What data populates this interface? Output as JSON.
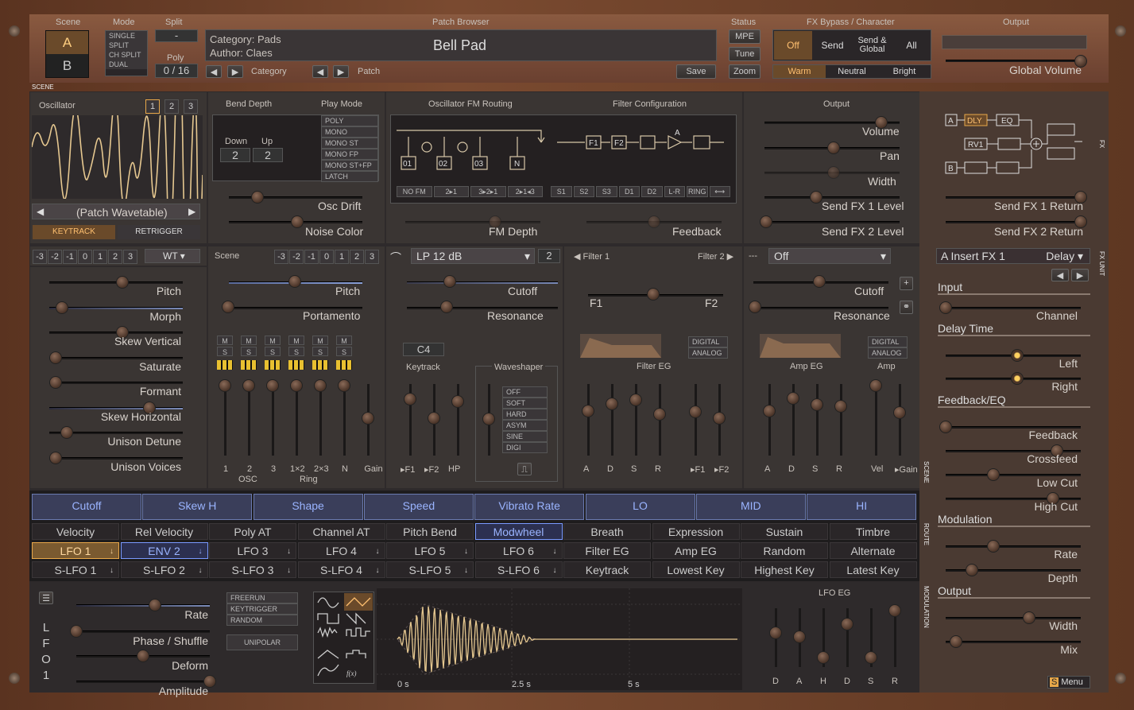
{
  "header": {
    "scene": "Scene",
    "scene_a": "A",
    "scene_b": "B",
    "mode": "Mode",
    "modes": [
      "SINGLE",
      "SPLIT",
      "CH SPLIT",
      "DUAL"
    ],
    "split": "Split",
    "split_val": "-",
    "poly": "Poly",
    "poly_val": "0 / 16",
    "patch_browser": "Patch Browser",
    "category": "Category: Pads",
    "author": "Author: Claes",
    "patch_name": "Bell Pad",
    "category_label": "Category",
    "patch_label": "Patch",
    "save": "Save",
    "status": "Status",
    "mpe": "MPE",
    "tune": "Tune",
    "zoom": "Zoom",
    "fx_bypass": "FX Bypass / Character",
    "fx_buttons": [
      "Off",
      "Send",
      "Send &\nGlobal",
      "All"
    ],
    "character": [
      "Warm",
      "Neutral",
      "Bright"
    ],
    "output": "Output",
    "global_volume": "Global Volume",
    "scene_tag": "SCENE"
  },
  "osc": {
    "title": "Oscillator",
    "nums": [
      "1",
      "2",
      "3"
    ],
    "wavetable": "(Patch Wavetable)",
    "keytrack": "KEYTRACK",
    "retrigger": "RETRIGGER",
    "oct": [
      "-3",
      "-2",
      "-1",
      "0",
      "1",
      "2",
      "3"
    ],
    "type": "WT",
    "params": [
      "Pitch",
      "Morph",
      "Skew Vertical",
      "Saturate",
      "Formant",
      "Skew Horizontal",
      "Unison Detune",
      "Unison Voices"
    ]
  },
  "bend": {
    "title": "Bend Depth",
    "down": "Down",
    "up": "Up",
    "down_val": "2",
    "up_val": "2",
    "play_mode": "Play Mode",
    "modes": [
      "POLY",
      "MONO",
      "MONO ST",
      "MONO FP",
      "MONO ST+FP",
      "LATCH"
    ],
    "osc_drift": "Osc Drift",
    "noise_color": "Noise Color"
  },
  "fm": {
    "title": "Oscillator FM Routing",
    "filter_config": "Filter Configuration",
    "fm_opts": [
      "NO FM",
      "2▸1",
      "3▸2▸1",
      "2▸1◂3"
    ],
    "filt_opts": [
      "S1",
      "S2",
      "S3",
      "D1",
      "D2",
      "L-R",
      "RING",
      "⟷"
    ],
    "fm_depth": "FM Depth",
    "feedback": "Feedback",
    "nodes": [
      "01",
      "02",
      "03",
      "N",
      "F1",
      "F2",
      "A"
    ]
  },
  "out": {
    "title": "Output",
    "params": [
      "Volume",
      "Pan",
      "Width",
      "Send FX 1 Level",
      "Send FX 2 Level"
    ]
  },
  "fx": {
    "routing": [
      "A",
      "DLY",
      "EQ",
      "RV1",
      "B"
    ],
    "returns": [
      "Send FX 1 Return",
      "Send FX 2 Return"
    ],
    "insert": "A Insert FX 1",
    "insert_type": "Delay",
    "input": "Input",
    "channel": "Channel",
    "delay_time": "Delay Time",
    "left": "Left",
    "right": "Right",
    "feedback_eq": "Feedback/EQ",
    "feedback": "Feedback",
    "crossfeed": "Crossfeed",
    "low_cut": "Low Cut",
    "high_cut": "High Cut",
    "modulation": "Modulation",
    "rate": "Rate",
    "depth": "Depth",
    "output": "Output",
    "width": "Width",
    "mix": "Mix",
    "menu": "Menu",
    "fx_tag": "FX",
    "fx_unit": "FX UNIT"
  },
  "mixer": {
    "scene": "Scene",
    "pitch": "Pitch",
    "portamento": "Portamento",
    "ch": [
      "1",
      "2",
      "3",
      "1×2",
      "2×3",
      "N",
      "Gain"
    ],
    "osc": "OSC",
    "ring": "Ring"
  },
  "filter": {
    "type": "LP 12 dB",
    "num": "2",
    "filter1": "Filter 1",
    "filter2": "Filter 2",
    "cutoff": "Cutoff",
    "resonance": "Resonance",
    "note": "C4",
    "keytrack": "Keytrack",
    "waveshaper": "Waveshaper",
    "ws_opts": [
      "OFF",
      "SOFT",
      "HARD",
      "ASYM",
      "SINE",
      "DIGI"
    ],
    "f_labels": [
      "▸F1",
      "▸F2",
      "HP"
    ],
    "f1": "F1",
    "f2": "F2",
    "digital": "DIGITAL",
    "analog": "ANALOG",
    "filter_eg": "Filter EG",
    "amp_eg": "Amp EG",
    "amp": "Amp",
    "adsr": [
      "A",
      "D",
      "S",
      "R"
    ],
    "feg_extra": [
      "▸F1",
      "▸F2"
    ],
    "amp_extra": [
      "Vel",
      "▸Gain"
    ],
    "f2_type": "Off",
    "f2_dash": "---"
  },
  "mod": {
    "macros": [
      "Cutoff",
      "Skew H",
      "Shape",
      "Speed",
      "Vibrato Rate",
      "LO",
      "MID",
      "HI"
    ],
    "row1": [
      "Velocity",
      "Rel Velocity",
      "Poly AT",
      "Channel AT",
      "Pitch Bend",
      "Modwheel",
      "Breath",
      "Expression",
      "Sustain",
      "Timbre"
    ],
    "row2": [
      "LFO 1",
      "ENV 2",
      "LFO 3",
      "LFO 4",
      "LFO 5",
      "LFO 6",
      "Filter EG",
      "Amp EG",
      "Random",
      "Alternate"
    ],
    "row3": [
      "S-LFO 1",
      "S-LFO 2",
      "S-LFO 3",
      "S-LFO 4",
      "S-LFO 5",
      "S-LFO 6",
      "Keytrack",
      "Lowest Key",
      "Highest Key",
      "Latest Key"
    ],
    "route": "ROUTE",
    "scene_tag": "SCENE",
    "modulation_tag": "MODULATION"
  },
  "lfo": {
    "name": "LFO 1",
    "params": [
      "Rate",
      "Phase / Shuffle",
      "Deform",
      "Amplitude"
    ],
    "trig": [
      "FREERUN",
      "KEYTRIGGER",
      "RANDOM"
    ],
    "unipolar": "UNIPOLAR",
    "eg": "LFO EG",
    "eg_labels": [
      "D",
      "A",
      "H",
      "D",
      "S",
      "R"
    ],
    "times": [
      "0 s",
      "2.5 s",
      "5 s"
    ],
    "fmath": "f(x)"
  }
}
